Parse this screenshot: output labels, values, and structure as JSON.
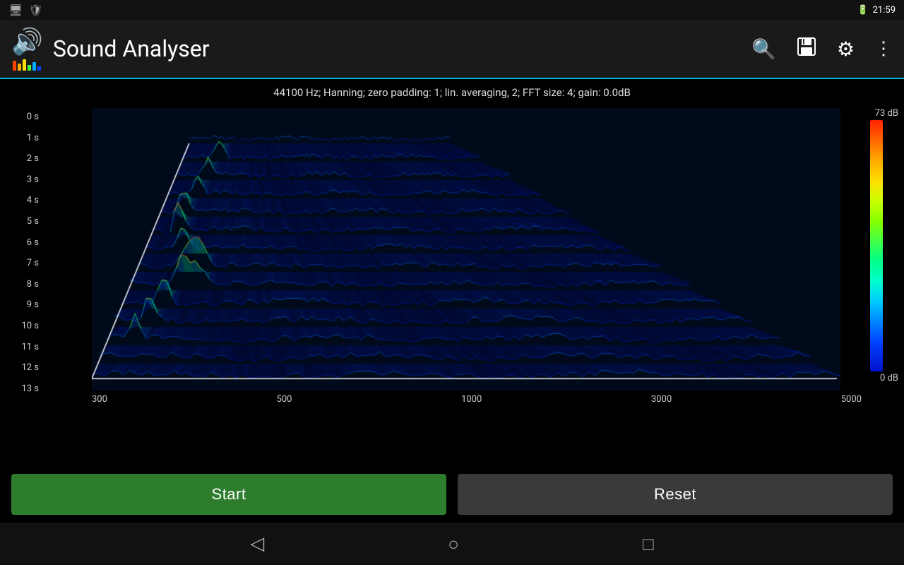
{
  "statusBar": {
    "time": "21:59",
    "batteryIcon": "🔋"
  },
  "appBar": {
    "title": "Sound Analyser",
    "actions": {
      "search": "🔍",
      "save": "💾",
      "settings": "⚙",
      "more": "⋮"
    }
  },
  "settings": {
    "infoText": "44100 Hz; Hanning; zero padding: 1; lin. averaging, 2; FFT size: 4; gain: 0.0dB"
  },
  "yAxis": {
    "labels": [
      "0 s",
      "1 s",
      "2 s",
      "3 s",
      "4 s",
      "5 s",
      "6 s",
      "7 s",
      "8 s",
      "9 s",
      "10 s",
      "11 s",
      "12 s",
      "13 s"
    ]
  },
  "xAxis": {
    "labels": [
      "300",
      "500",
      "1000",
      "3000",
      "5000"
    ]
  },
  "dbScale": {
    "top": "73 dB",
    "bottom": "0 dB"
  },
  "buttons": {
    "start": "Start",
    "reset": "Reset"
  },
  "navBar": {
    "back": "◁",
    "home": "○",
    "recent": "□"
  },
  "soundBars": [
    {
      "color": "#ff4400",
      "height": 14
    },
    {
      "color": "#ffaa00",
      "height": 10
    },
    {
      "color": "#ffdd00",
      "height": 16
    },
    {
      "color": "#44ff44",
      "height": 8
    },
    {
      "color": "#00aaff",
      "height": 12
    },
    {
      "color": "#0044ff",
      "height": 6
    }
  ]
}
